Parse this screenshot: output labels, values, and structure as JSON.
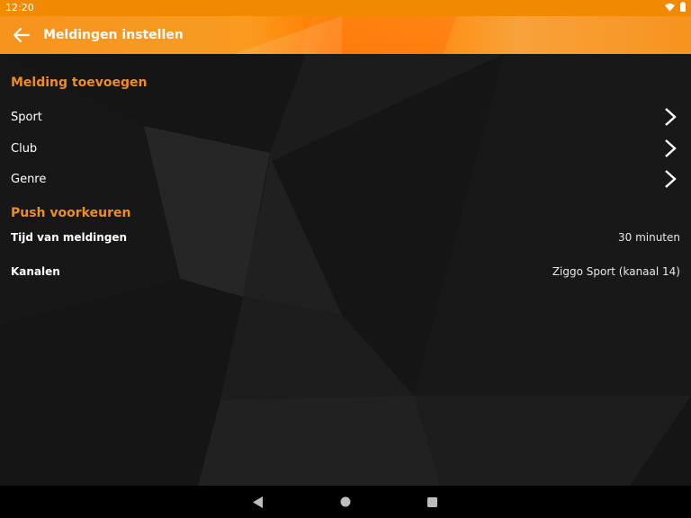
{
  "status_bar": {
    "time": "12:20",
    "icons": [
      "wifi-icon",
      "battery-icon"
    ]
  },
  "app_bar": {
    "title": "Meldingen instellen",
    "back_icon": "arrow-left-icon"
  },
  "sections": {
    "add_notification": {
      "title": "Melding toevoegen",
      "items": [
        {
          "label": "Sport"
        },
        {
          "label": "Club"
        },
        {
          "label": "Genre"
        }
      ]
    },
    "push_preferences": {
      "title": "Push voorkeuren",
      "items": [
        {
          "label": "Tijd van meldingen",
          "value": "30 minuten"
        },
        {
          "label": "Kanalen",
          "value": "Ziggo Sport (kanaal 14)"
        }
      ]
    }
  },
  "colors": {
    "accent": "#f28c1e",
    "app_bar": "#f7931e",
    "background": "#151515"
  },
  "nav_bar": {
    "buttons": [
      "back-triangle-icon",
      "home-circle-icon",
      "recents-square-icon"
    ]
  }
}
